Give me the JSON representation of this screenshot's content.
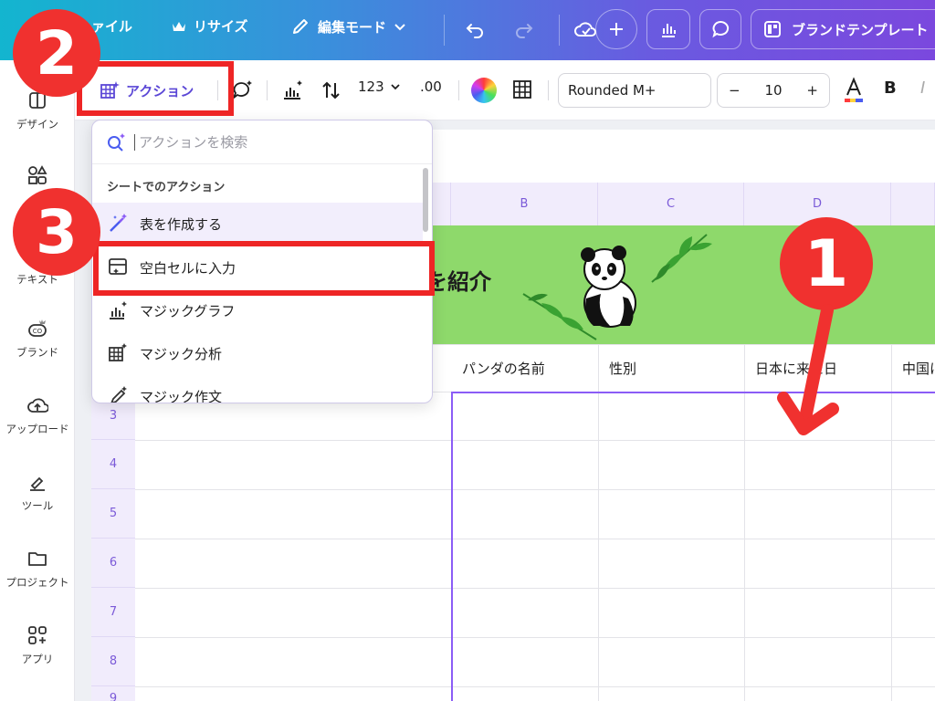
{
  "topbar": {
    "file_label": "ァイル",
    "resize_label": "リサイズ",
    "edit_mode_label": "編集モード",
    "brand_template_label": "ブランドテンプレート"
  },
  "sidebar": {
    "items": [
      {
        "label": "デザイン",
        "icon": "design-icon"
      },
      {
        "label": "素材",
        "icon": "elements-icon"
      },
      {
        "label": "テキスト",
        "icon": "text-icon"
      },
      {
        "label": "ブランド",
        "icon": "brand-icon"
      },
      {
        "label": "アップロード",
        "icon": "upload-icon"
      },
      {
        "label": "ツール",
        "icon": "tools-icon"
      },
      {
        "label": "プロジェクト",
        "icon": "folder-icon"
      },
      {
        "label": "アプリ",
        "icon": "apps-icon"
      }
    ]
  },
  "toolbar": {
    "action_label": "アクション",
    "number_format": "123",
    "decimal": ".00",
    "font_name": "Rounded M+",
    "font_size": "10",
    "minus": "−",
    "plus": "+",
    "bold": "B",
    "italic": "I"
  },
  "grid": {
    "columns": [
      "B",
      "C",
      "D"
    ],
    "rows": [
      "3",
      "4",
      "5",
      "6",
      "7",
      "8",
      "9"
    ],
    "title_fragment": "を紹介",
    "headers": [
      "パンダの名前",
      "性別",
      "日本に来た日",
      "中国に"
    ]
  },
  "dropdown": {
    "search_placeholder": "アクションを検索",
    "section_title": "シートでのアクション",
    "items": [
      {
        "label": "表を作成する",
        "icon": "magic-wand-icon"
      },
      {
        "label": "空白セルに入力",
        "icon": "fill-cells-icon"
      },
      {
        "label": "マジックグラフ",
        "icon": "chart-icon"
      },
      {
        "label": "マジック分析",
        "icon": "analysis-icon"
      },
      {
        "label": "マジック作文",
        "icon": "magic-write-icon"
      }
    ]
  },
  "annotations": {
    "badge1": "1",
    "badge2": "2",
    "badge3": "3",
    "accent_color": "#f0312f"
  }
}
